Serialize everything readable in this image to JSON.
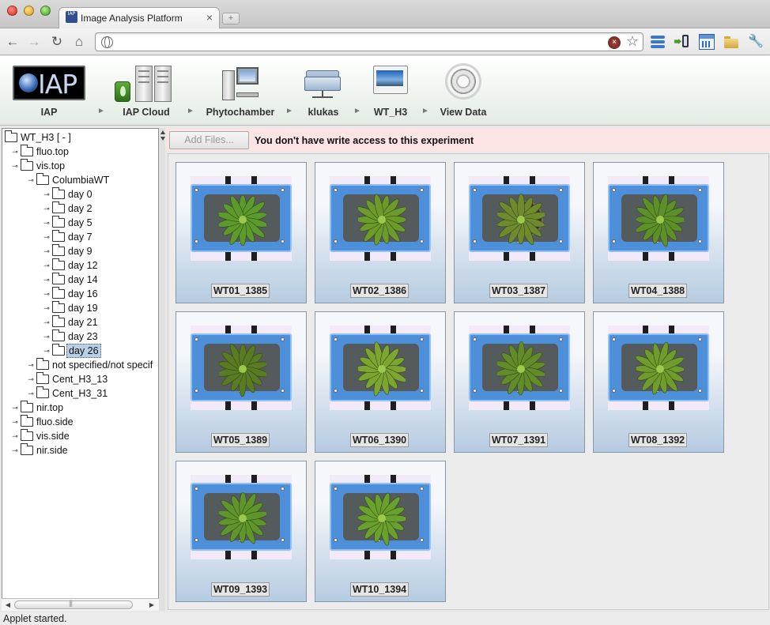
{
  "browser": {
    "tab_title": "Image Analysis Platform",
    "tab_favicon_text": "IAP",
    "tab_close": "×",
    "new_tab": "+",
    "address_value": "",
    "icons": [
      "back-arrow-icon",
      "forward-arrow-icon",
      "reload-icon",
      "home-icon",
      "globe-icon",
      "stop-icon",
      "star-icon",
      "layers-extension-icon",
      "phone-extension-icon",
      "calendar-extension-icon",
      "folder-extension-icon",
      "wrench-icon"
    ]
  },
  "navbar": {
    "logo_text": "IAP",
    "items": [
      {
        "label": "IAP",
        "icon": "iap-logo-icon"
      },
      {
        "label": "IAP Cloud",
        "icon": "server-cloud-icon"
      },
      {
        "label": "Phytochamber",
        "icon": "computer-icon"
      },
      {
        "label": "klukas",
        "icon": "network-folder-icon"
      },
      {
        "label": "WT_H3",
        "icon": "window-icon"
      },
      {
        "label": "View Data",
        "icon": "gear-icon"
      }
    ],
    "separator": "►"
  },
  "tree": {
    "root": "WT_H3 [ -        ]",
    "nodes": [
      {
        "label": "fluo.top",
        "toggle": "⊸"
      },
      {
        "label": "vis.top",
        "toggle": "⊸"
      },
      {
        "label": "ColumbiaWT",
        "toggle": "⊸"
      },
      {
        "label": "day 0",
        "toggle": "⊸"
      },
      {
        "label": "day 2",
        "toggle": "⊸"
      },
      {
        "label": "day 5",
        "toggle": "⊸"
      },
      {
        "label": "day 7",
        "toggle": "⊸"
      },
      {
        "label": "day 9",
        "toggle": "⊸"
      },
      {
        "label": "day 12",
        "toggle": "⊸"
      },
      {
        "label": "day 14",
        "toggle": "⊸"
      },
      {
        "label": "day 16",
        "toggle": "⊸"
      },
      {
        "label": "day 19",
        "toggle": "⊸"
      },
      {
        "label": "day 21",
        "toggle": "⊸"
      },
      {
        "label": "day 23",
        "toggle": "⊸"
      },
      {
        "label": "day 26",
        "toggle": "⊸",
        "selected": true
      },
      {
        "label": "not specified/not specif",
        "toggle": "⊸"
      },
      {
        "label": "Cent_H3_13",
        "toggle": "⊸"
      },
      {
        "label": "Cent_H3_31",
        "toggle": "⊸"
      },
      {
        "label": "nir.top",
        "toggle": "⊸"
      },
      {
        "label": "fluo.side",
        "toggle": "⊸"
      },
      {
        "label": "vis.side",
        "toggle": "⊸"
      },
      {
        "label": "nir.side",
        "toggle": "⊸"
      }
    ],
    "scroll_left": "◀",
    "scroll_right": "▶"
  },
  "main": {
    "add_files_label": "Add Files...",
    "warning": "You don't have write access to this experiment",
    "images": [
      {
        "caption": "WT01_1385",
        "leaf": "#5d9a2e",
        "pot": false
      },
      {
        "caption": "WT02_1386",
        "leaf": "#6c9b2c",
        "pot": false
      },
      {
        "caption": "WT03_1387",
        "leaf": "#6f8a2e",
        "pot": true
      },
      {
        "caption": "WT04_1388",
        "leaf": "#5e902a",
        "pot": false
      },
      {
        "caption": "WT05_1389",
        "leaf": "#5a7a24",
        "pot": false
      },
      {
        "caption": "WT06_1390",
        "leaf": "#7ea531",
        "pot": false
      },
      {
        "caption": "WT07_1391",
        "leaf": "#638b2a",
        "pot": false
      },
      {
        "caption": "WT08_1392",
        "leaf": "#6f9c2d",
        "pot": false
      },
      {
        "caption": "WT09_1393",
        "leaf": "#5f952c",
        "pot": false
      },
      {
        "caption": "WT10_1394",
        "leaf": "#6aa02d",
        "pot": false
      }
    ]
  },
  "status": {
    "text": "Applet started."
  },
  "colors": {
    "warning_bg": "#fde4e4",
    "card_gradient_bottom": "#b6cbe1",
    "tray_blue": "#4e8fd9",
    "selection": "#b8cfe5"
  }
}
